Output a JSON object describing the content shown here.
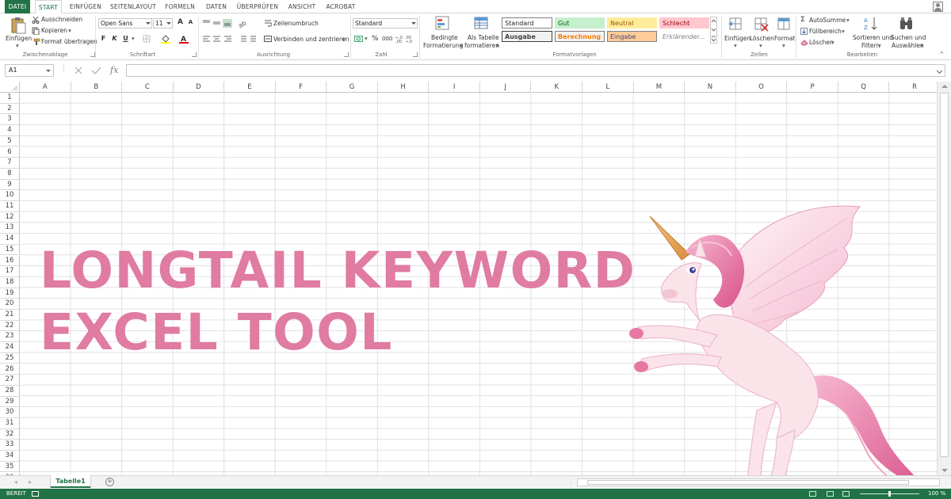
{
  "tabs": [
    {
      "label": "DATEI",
      "active": false
    },
    {
      "label": "START",
      "active": true
    },
    {
      "label": "EINFÜGEN",
      "active": false
    },
    {
      "label": "SEITENLAYOUT",
      "active": false
    },
    {
      "label": "FORMELN",
      "active": false
    },
    {
      "label": "DATEN",
      "active": false
    },
    {
      "label": "ÜBERPRÜFEN",
      "active": false
    },
    {
      "label": "ANSICHT",
      "active": false
    },
    {
      "label": "ACROBAT",
      "active": false
    }
  ],
  "clipboard": {
    "paste": "Einfügen",
    "cut": "Ausschneiden",
    "copy": "Kopieren",
    "format_painter": "Format übertragen",
    "group": "Zwischenablage"
  },
  "font": {
    "name": "Open Sans",
    "size": "11",
    "bold": "F",
    "italic": "K",
    "underline": "U",
    "grow": "A",
    "shrink": "A",
    "group": "Schriftart"
  },
  "alignment": {
    "wrap": "Zeilenumbruch",
    "merge": "Verbinden und zentrieren",
    "group": "Ausrichtung"
  },
  "number": {
    "format": "Standard",
    "percent": "%",
    "thousands": "000",
    "group": "Zahl"
  },
  "styles": {
    "cond_format_1": "Bedingte",
    "cond_format_2": "Formatierung",
    "as_table_1": "Als Tabelle",
    "as_table_2": "formatieren",
    "cells": [
      {
        "label": "Standard",
        "bg": "#ffffff",
        "fg": "#222222",
        "border": "#7f7f7f"
      },
      {
        "label": "Gut",
        "bg": "#c6efce",
        "fg": "#006100",
        "border": "#c6efce"
      },
      {
        "label": "Neutral",
        "bg": "#ffeb9c",
        "fg": "#9c5700",
        "border": "#ffeb9c"
      },
      {
        "label": "Schlecht",
        "bg": "#ffc7ce",
        "fg": "#9c0006",
        "border": "#ffc7ce"
      },
      {
        "label": "Ausgabe",
        "bg": "#f2f2f2",
        "fg": "#3f3f3f",
        "border": "#3f3f3f"
      },
      {
        "label": "Berechnung",
        "bg": "#f2f2f2",
        "fg": "#fa7d00",
        "border": "#7f7f7f"
      },
      {
        "label": "Eingabe",
        "bg": "#ffcc99",
        "fg": "#3f3f76",
        "border": "#7f7f7f"
      },
      {
        "label": "Erklärender...",
        "bg": "#ffffff",
        "fg": "#7f7f7f",
        "border": "#ffffff"
      }
    ],
    "group": "Formatvorlagen"
  },
  "cells_group": {
    "insert": "Einfügen",
    "delete": "Löschen",
    "format": "Format",
    "group": "Zellen"
  },
  "editing": {
    "autosum": "AutoSumme",
    "fill": "Füllbereich",
    "clear": "Löschen",
    "sort_1": "Sortieren und",
    "sort_2": "Filtern",
    "find_1": "Suchen und",
    "find_2": "Auswählen",
    "group": "Bearbeiten"
  },
  "formula_bar": {
    "name_box": "A1",
    "fx": "fx",
    "value": ""
  },
  "columns": [
    "A",
    "B",
    "C",
    "D",
    "E",
    "F",
    "G",
    "H",
    "I",
    "J",
    "K",
    "L",
    "M",
    "N",
    "O",
    "P",
    "Q",
    "R"
  ],
  "rows": [
    "1",
    "2",
    "3",
    "4",
    "5",
    "6",
    "7",
    "8",
    "9",
    "10",
    "11",
    "12",
    "13",
    "14",
    "15",
    "16",
    "17",
    "18",
    "19",
    "20",
    "21",
    "22",
    "23",
    "24",
    "25",
    "26",
    "27",
    "28",
    "29",
    "30",
    "31",
    "32",
    "33",
    "34",
    "35",
    "36"
  ],
  "headline": {
    "line1": "LONGTAIL KEYWORD",
    "line2": "EXCEL TOOL",
    "color": "#e07ba2"
  },
  "sheet": {
    "tab": "Tabelle1",
    "add": "+"
  },
  "status": {
    "ready": "BEREIT",
    "zoom": "100 %"
  },
  "colors": {
    "accent": "#217346"
  },
  "icons": [
    "paste-icon",
    "cut-icon",
    "copy-icon",
    "format-painter-icon",
    "wrap-text-icon",
    "merge-icon",
    "conditional-format-icon",
    "format-as-table-icon",
    "insert-cells-icon",
    "delete-cells-icon",
    "format-cells-icon",
    "autosum-icon",
    "fill-icon",
    "clear-icon",
    "sort-filter-icon",
    "find-select-icon",
    "unicorn-illustration"
  ]
}
